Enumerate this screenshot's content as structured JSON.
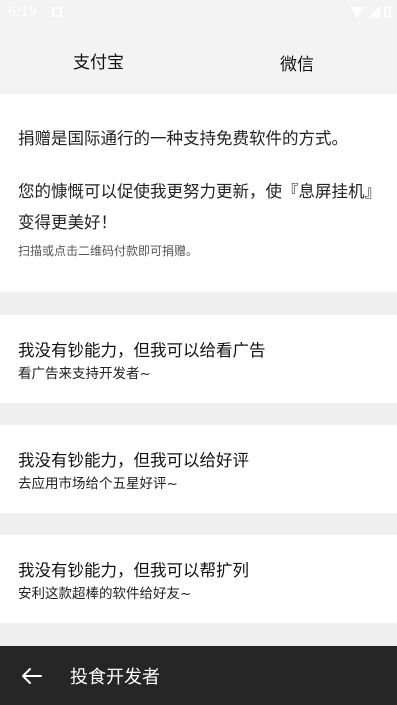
{
  "status_bar": {
    "time": "6:19"
  },
  "tabs": [
    {
      "label": "支付宝"
    },
    {
      "label": "微信"
    }
  ],
  "intro": {
    "line1": "捐赠是国际通行的一种支持免费软件的方式。",
    "line2": "您的慷慨可以促使我更努力更新，使『息屏挂机』变得更美好！",
    "hint": "扫描或点击二维码付款即可捐赠。"
  },
  "options": [
    {
      "title": "我没有钞能力，但我可以给看广告",
      "subtitle": "看广告来支持开发者~"
    },
    {
      "title": "我没有钞能力，但我可以给好评",
      "subtitle": "去应用市场给个五星好评~"
    },
    {
      "title": "我没有钞能力，但我可以帮扩列",
      "subtitle": "安利这款超棒的软件给好友~"
    }
  ],
  "bottom_bar": {
    "title": "投食开发者",
    "back_icon": "arrow-back-icon"
  }
}
